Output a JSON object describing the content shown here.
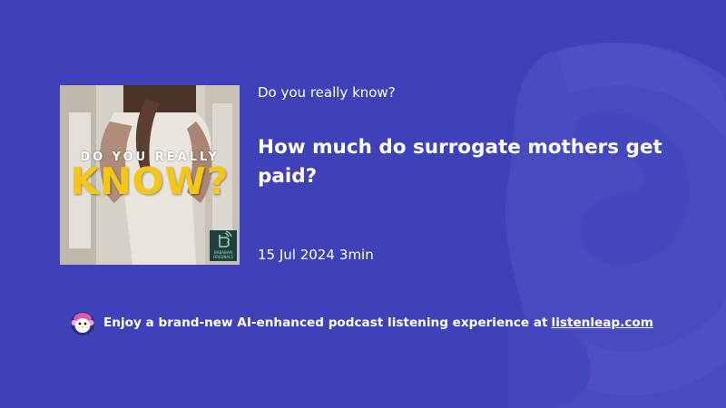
{
  "colors": {
    "background": "#3f41b9",
    "text": "#ffffff",
    "cover_title_yellow": "#f5c518"
  },
  "podcast": {
    "show_name": "Do you really know?",
    "cover": {
      "title_top": "DO YOU REALLY",
      "title_main": "KNOW?",
      "badge_line1": "BABABAM",
      "badge_line2": "ORIGINALS"
    }
  },
  "episode": {
    "title": "How much do surrogate mothers get paid?",
    "date": "15 Jul 2024",
    "duration": "3min"
  },
  "promo": {
    "text": "Enjoy a brand-new AI-enhanced podcast listening experience at",
    "link_text": "listenleap.com",
    "icon": "penguin-mascot-icon"
  },
  "background_logo_icon": "listenleap-logo-icon"
}
